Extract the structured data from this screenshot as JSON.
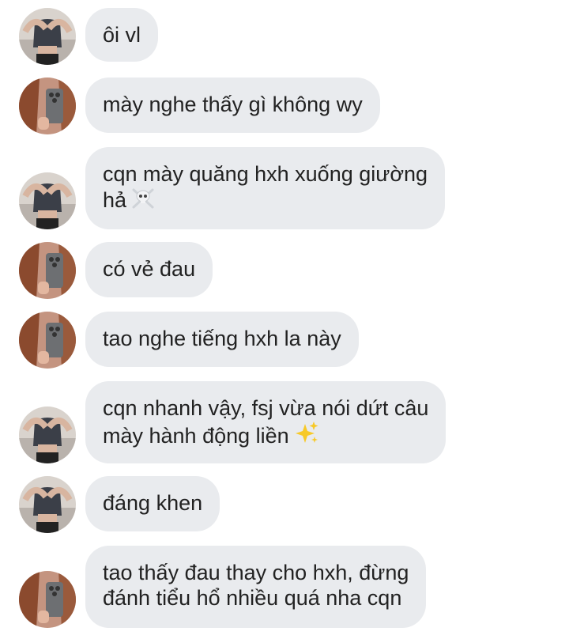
{
  "messages": [
    {
      "sender": "user-a",
      "lines": [
        "ôi vl"
      ]
    },
    {
      "sender": "user-b",
      "lines": [
        "mày nghe thấy gì không wy"
      ]
    },
    {
      "sender": "user-a",
      "lines": [
        "cqn mày quăng hxh xuống giường",
        "hả"
      ],
      "emoji": "skull-crossbones-icon"
    },
    {
      "sender": "user-b",
      "lines": [
        "có vẻ đau"
      ]
    },
    {
      "sender": "user-b",
      "lines": [
        "tao nghe tiếng hxh la này"
      ]
    },
    {
      "sender": "user-a",
      "lines": [
        "cqn nhanh vậy, fsj vừa nói dứt câu",
        "mày hành động liền"
      ],
      "emoji": "sparkles-icon"
    },
    {
      "sender": "user-a",
      "lines": [
        "đáng khen"
      ]
    },
    {
      "sender": "user-b",
      "lines": [
        "tao thấy đau thay cho hxh, đừng",
        "đánh tiểu hổ nhiều quá nha cqn"
      ]
    }
  ],
  "colors": {
    "bubble_background": "#e9ebee",
    "text": "#222222",
    "avatar_a_background": "#d9d3cd",
    "avatar_b_background": "#c49480"
  }
}
